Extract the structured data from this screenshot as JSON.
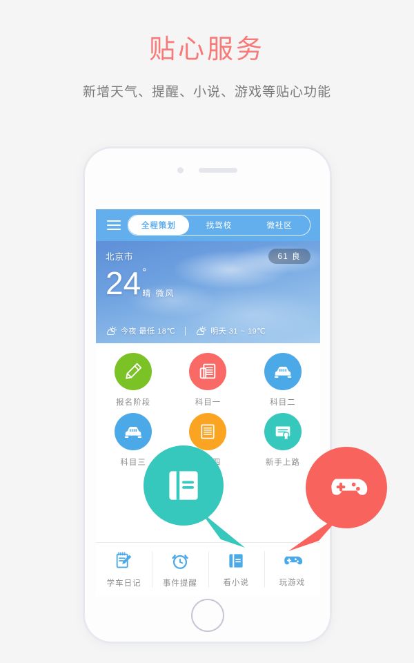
{
  "promo": {
    "title": "贴心服务",
    "subtitle": "新增天气、提醒、小说、游戏等贴心功能",
    "title_color": "#f87a78",
    "subtitle_color": "#7a7a7a",
    "background_color": "#f5f5f5"
  },
  "app": {
    "navbar": {
      "menu_icon": "hamburger-icon",
      "background_color": "#63aeec",
      "segments": [
        {
          "label": "全程策划",
          "active": true
        },
        {
          "label": "找驾校",
          "active": false
        },
        {
          "label": "微社区",
          "active": false
        }
      ]
    },
    "weather": {
      "city": "北京市",
      "aqi_badge": "61 良",
      "temperature": "24",
      "degree_symbol": "°",
      "condition": "晴 微风",
      "forecast": [
        {
          "icon": "sun-behind-cloud-icon",
          "text": "今夜 最低 18℃"
        },
        {
          "icon": "sun-behind-cloud-icon",
          "text": "明天 31 ~ 19℃"
        }
      ]
    },
    "grid": [
      {
        "label": "报名阶段",
        "icon": "pencil-icon",
        "color": "#7ac225"
      },
      {
        "label": "科目一",
        "icon": "document-icon",
        "color": "#f96a66"
      },
      {
        "label": "科目二",
        "icon": "car-icon",
        "color": "#4ba9e8"
      },
      {
        "label": "科目三",
        "icon": "car-icon",
        "color": "#4ba9e8"
      },
      {
        "label": "科目四",
        "icon": "document-icon",
        "color": "#fba421"
      },
      {
        "label": "新手上路",
        "icon": "certificate-icon",
        "color": "#37c8bd"
      }
    ],
    "tabbar": [
      {
        "label": "学车日记",
        "icon": "notebook-pencil-icon",
        "color": "#4ba9e8"
      },
      {
        "label": "事件提醒",
        "icon": "alarm-clock-icon",
        "color": "#4ba9e8"
      },
      {
        "label": "看小说",
        "icon": "book-icon",
        "color": "#4ba9e8"
      },
      {
        "label": "玩游戏",
        "icon": "gamepad-icon",
        "color": "#4ba9e8"
      }
    ]
  },
  "callouts": [
    {
      "name": "book-callout",
      "icon": "book-icon",
      "color": "#37c8bd",
      "points_to": "看小说"
    },
    {
      "name": "game-callout",
      "icon": "gamepad-icon",
      "color": "#f9635e",
      "points_to": "玩游戏"
    }
  ]
}
